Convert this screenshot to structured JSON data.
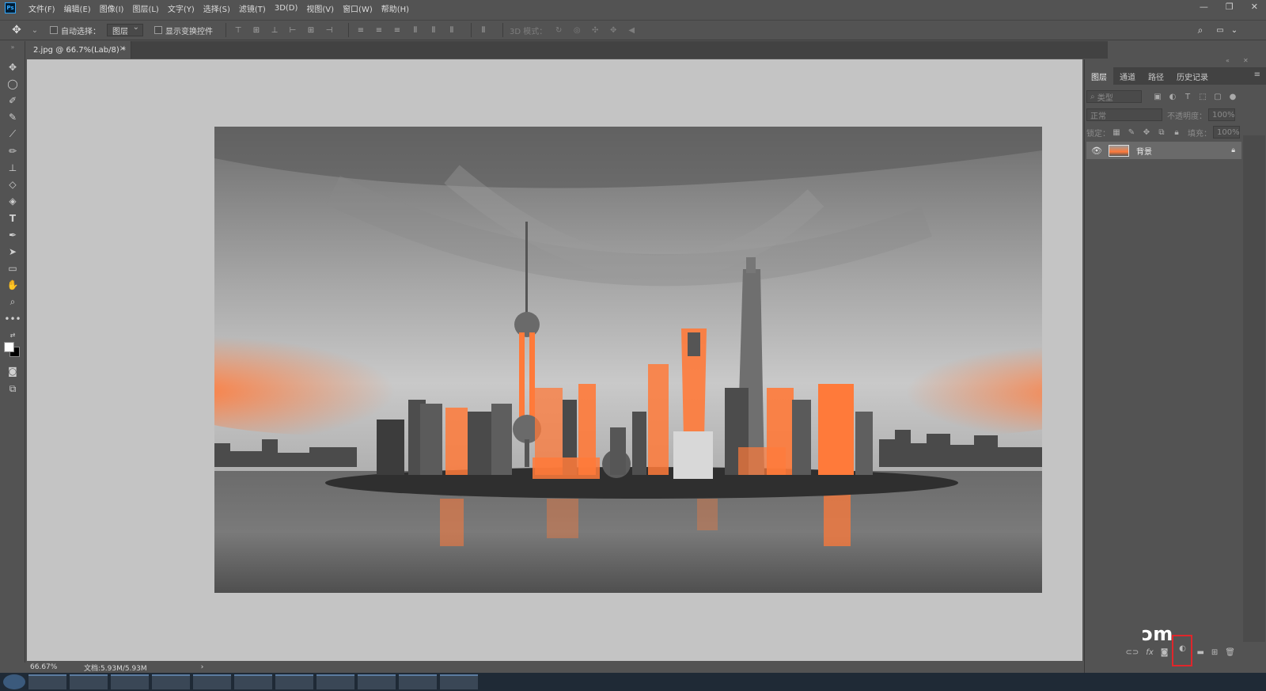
{
  "menubar": {
    "app_icon": "Ps",
    "items": [
      "文件(F)",
      "编辑(E)",
      "图像(I)",
      "图层(L)",
      "文字(Y)",
      "选择(S)",
      "滤镜(T)",
      "3D(D)",
      "视图(V)",
      "窗口(W)",
      "帮助(H)"
    ],
    "window_controls": [
      "minimize-icon",
      "restore-icon",
      "close-icon"
    ]
  },
  "options_bar": {
    "auto_select_label": "自动选择：",
    "auto_select_value": "图层",
    "show_transform_label": "显示变换控件",
    "mode_3d_label": "3D 模式："
  },
  "document": {
    "tab_title": "2.jpg @ 66.7%(Lab/8) *",
    "tab_close": "×"
  },
  "status": {
    "zoom": "66.67%",
    "doc_size": "文档:5.93M/5.93M",
    "arrow": "›"
  },
  "panel": {
    "tabs": [
      "图层",
      "通道",
      "路径",
      "历史记录"
    ],
    "active_tab": "图层",
    "filter_kind": "类型",
    "blend_mode": "正常",
    "opacity_label": "不透明度：",
    "opacity_value": "100%",
    "lock_label": "锁定：",
    "fill_label": "填充：",
    "fill_value": "100%",
    "layer_name": "背景",
    "menu_icon": "≡",
    "footer_icons": [
      "link-icon",
      "fx-icon",
      "mask-icon",
      "adjustment-icon",
      "folder-icon",
      "new-layer-icon",
      "trash-icon"
    ]
  },
  "annotation": {
    "highlight_color": "#e0262b",
    "highlighted": "adjustment-icon"
  },
  "colors": {
    "accent_orange": "#ff7a3a",
    "ps_blue": "#31a8ff"
  }
}
